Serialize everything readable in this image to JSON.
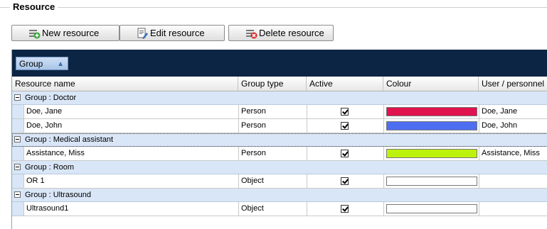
{
  "section": {
    "title": "Resource"
  },
  "toolbar": {
    "new_label": "New resource",
    "edit_label": "Edit resource",
    "delete_label": "Delete resource"
  },
  "group_panel": {
    "chip_label": "Group",
    "sort_indicator": "▲"
  },
  "columns": [
    "Resource name",
    "Group type",
    "Active",
    "Colour",
    "User / personnel"
  ],
  "groups": [
    {
      "label": "Group : Doctor",
      "rows": [
        {
          "name": "Doe, Jane",
          "type": "Person",
          "active": true,
          "colour": "#e0134f",
          "user": "Doe, Jane"
        },
        {
          "name": "Doe, John",
          "type": "Person",
          "active": true,
          "colour": "#4d6ef0",
          "user": "Doe, John"
        }
      ]
    },
    {
      "label": "Group : Medical assistant",
      "rows": [
        {
          "name": "Assistance, Miss",
          "type": "Person",
          "active": true,
          "colour": "#bdf20c",
          "user": "Assistance, Miss"
        }
      ]
    },
    {
      "label": "Group : Room",
      "rows": [
        {
          "name": "OR 1",
          "type": "Object",
          "active": true,
          "colour": "#ffffff",
          "user": ""
        }
      ]
    },
    {
      "label": "Group : Ultrasound",
      "rows": [
        {
          "name": "Ultrasound1",
          "type": "Object",
          "active": true,
          "colour": "#ffffff",
          "user": ""
        }
      ]
    }
  ]
}
